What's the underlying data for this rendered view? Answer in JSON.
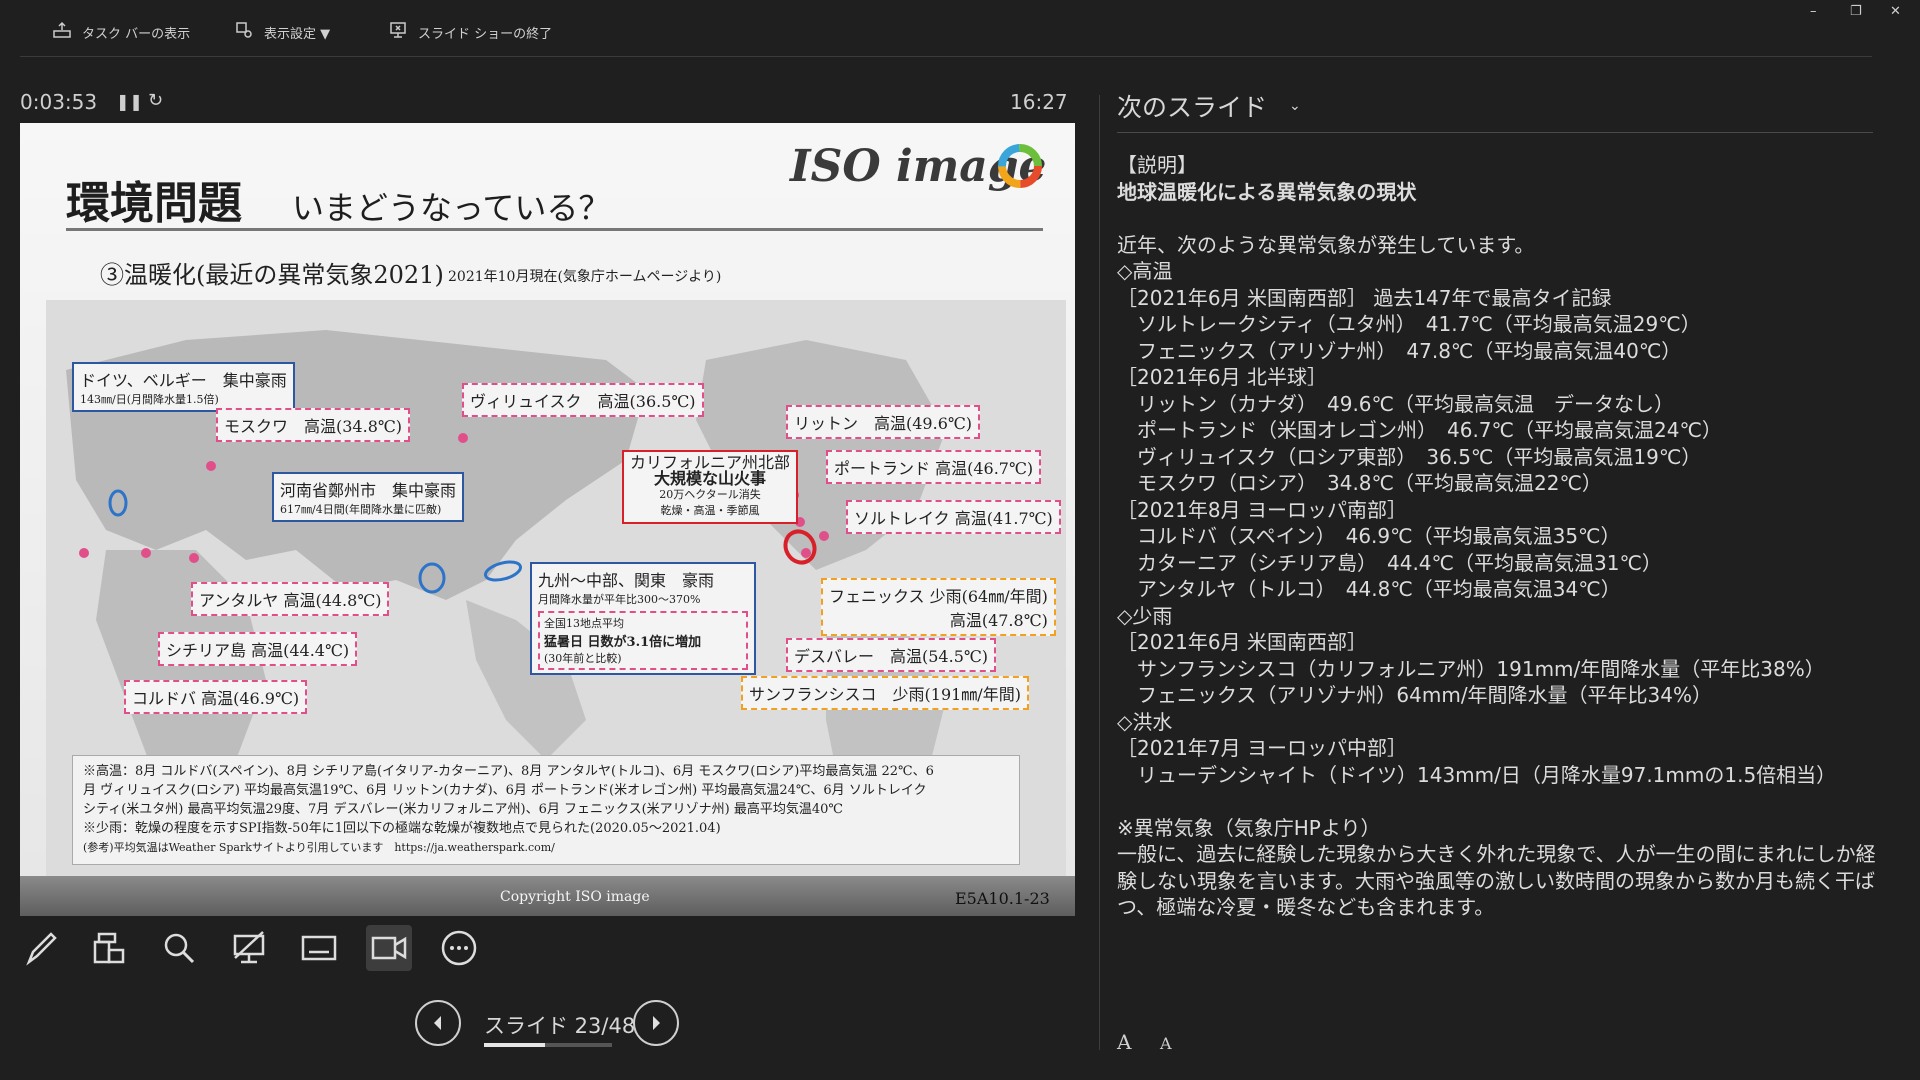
{
  "toolbar": {
    "taskbar_label": "タスク バーの表示",
    "display_settings_label": "表示設定 ▼",
    "end_show_label": "スライド ショーの終了"
  },
  "window_controls": {
    "minimize": "–",
    "restore": "❐",
    "close": "✕"
  },
  "presenter": {
    "elapsed_time": "0:03:53",
    "clock": "16:27",
    "slide_counter": "スライド 23/48",
    "current_slide": 23,
    "total_slides": 48
  },
  "slide": {
    "title": "環境問題",
    "subtitle": "いまどうなっている？",
    "logo_text": "ISO image",
    "section": "③温暖化(最近の異常気象2021)",
    "date_note": "2021年10月現在(気象庁ホームページより)",
    "labels": {
      "germany": "ドイツ、ベルギー　集中豪雨",
      "germany_sub": "143㎜/日(月間降水量1.5倍)",
      "moscow": "モスクワ　高温(34.8℃)",
      "verkhoyansk": "ヴィリュイスク　高温(36.5℃)",
      "lytton": "リットン　高温(49.6℃)",
      "california": "カリフォルニア州北部",
      "california_2": "大規模な山火事",
      "california_3": "20万ヘクタール消失",
      "california_4": "乾燥・高温・季節風",
      "portland": "ポートランド 高温(46.7℃)",
      "saltlake": "ソルトレイク 高温(41.7℃)",
      "zhengzhou": "河南省鄭州市　集中豪雨",
      "zhengzhou_sub": "617㎜/4日間(年間降水量に匹敵)",
      "antalya": "アンタルヤ 高温(44.8℃)",
      "sicily": "シチリア島 高温(44.4℃)",
      "cordoba": "コルドバ 高温(46.9℃)",
      "kyushu": "九州～中部、関東　豪雨",
      "kyushu_sub": "月間降水量が平年比300～370%",
      "heat_days": "全国13地点平均",
      "heat_days_2": "猛暑日 日数が3.1倍に増加",
      "heat_days_3": "(30年前と比較)",
      "phoenix": "フェニックス 少雨(64㎜/年間)",
      "phoenix_2": "高温(47.8℃)",
      "deathvalley": "デスバレー　高温(54.5℃)",
      "sanfrancisco": "サンフランシスコ　少雨(191㎜/年間)"
    },
    "notes_box": [
      "※高温：8月 コルドバ(スペイン)、8月 シチリア島(イタリア-カターニア)、8月 アンタルヤ(トルコ)、6月 モスクワ(ロシア)平均最高気温 22℃、6",
      "月 ヴィリュイスク(ロシア) 平均最高気温19℃、6月 リットン(カナダ)、6月 ポートランド(米オレゴン州) 平均最高気温24℃、6月 ソルトレイク",
      "シティ(米ユタ州) 最高平均気温29度、7月 デスバレー(米カリフォルニア州)、6月 フェニックス(米アリゾナ州) 最高平均気温40℃",
      "※少雨：乾燥の程度を示すSPI指数-50年に1回以下の極端な乾燥が複数地点で見られた(2020.05～2021.04)",
      "(参考)平均気温はWeather Sparkサイトより引用しています　https://ja.weatherspark.com/"
    ],
    "copyright": "Copyright ISO image",
    "code": "E5A10.1-23"
  },
  "notes_panel": {
    "header": "次のスライド",
    "lines": [
      "【説明】",
      "地球温暖化による異常気象の現状",
      "",
      "近年、次のような異常気象が発生しています。",
      "◇高温",
      "［2021年6月 米国南西部］ 過去147年で最高タイ記録",
      "　ソルトレークシティ（ユタ州）　41.7℃（平均最高気温29℃）",
      "　フェニックス（アリゾナ州）　47.8℃（平均最高気温40℃）",
      "［2021年6月 北半球］",
      "　リットン（カナダ）　49.6℃（平均最高気温　データなし）",
      "　ポートランド（米国オレゴン州）　46.7℃（平均最高気温24℃）",
      "　ヴィリュイスク（ロシア東部）　36.5℃（平均最高気温19℃）",
      "　モスクワ（ロシア）　34.8℃（平均最高気温22℃）",
      "［2021年8月 ヨーロッパ南部］",
      "　コルドバ（スペイン）　46.9℃（平均最高気温35℃）",
      "　カターニア（シチリア島）　44.4℃（平均最高気温31℃）",
      "　アンタルヤ（トルコ）　44.8℃（平均最高気温34℃）",
      "◇少雨",
      "［2021年6月 米国南西部］",
      "　サンフランシスコ（カリフォルニア州）191mm/年間降水量（平年比38%）",
      "　フェニックス（アリゾナ州）64mm/年間降水量（平年比34%）",
      "◇洪水",
      "［2021年7月 ヨーロッパ中部］",
      "　リューデンシャイト（ドイツ）143mm/日（月降水量97.1mmの1.5倍相当）",
      "",
      "※異常気象（気象庁HPより）",
      "一般に、過去に経験した現象から大きく外れた現象で、人が一生の間にまれにしか経",
      "験しない現象を言います。大雨や強風等の激しい数時間の現象から数か月も続く干ば",
      "つ、極端な冷夏・暖冬なども含まれます。"
    ],
    "font_increase": "A",
    "font_decrease": "A"
  },
  "icons": [
    "taskbar-icon",
    "display-settings-icon",
    "end-show-icon",
    "pause-icon",
    "restart-icon",
    "pen-icon",
    "all-slides-icon",
    "zoom-icon",
    "presentation-icon",
    "subtitles-icon",
    "camera-icon",
    "more-icon",
    "prev-arrow-icon",
    "next-arrow-icon",
    "dropdown-chevron-icon"
  ]
}
